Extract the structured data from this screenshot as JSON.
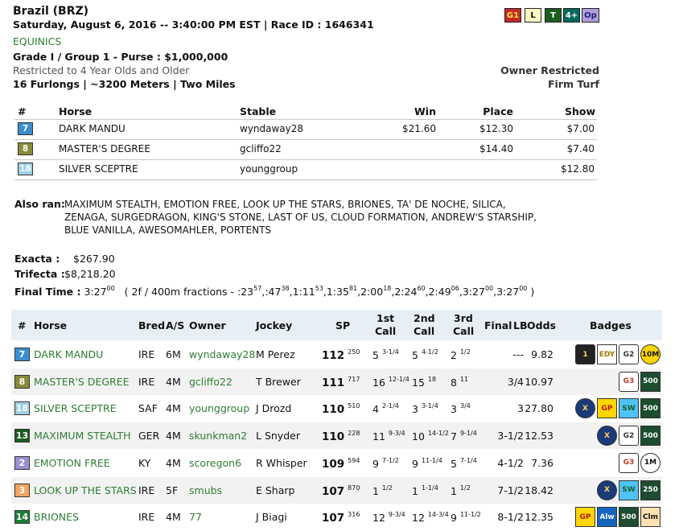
{
  "race": {
    "title": "Brazil (BRZ)",
    "date_line": "Saturday, August 6, 2016 -- 3:40:00 PM EST | Race ID : 1646341",
    "brand": "EQUINICS",
    "grade_line": "Grade I / Group 1 - Purse : $1,000,000",
    "restriction": "Restricted to 4 Year Olds and Older",
    "distance": "16 Furlongs | ~3200 Meters | Two Miles",
    "owner_restricted": "Owner Restricted",
    "surface": "Firm Turf",
    "tags": [
      {
        "label": "G1",
        "bg": "#c62828",
        "fg": "#ffeb3b"
      },
      {
        "label": "L",
        "bg": "#fff9c4",
        "fg": "#111"
      },
      {
        "label": "T",
        "bg": "#1b5e20",
        "fg": "#fff"
      },
      {
        "label": "4+",
        "bg": "#00695c",
        "fg": "#fff"
      },
      {
        "label": "Op",
        "bg": "#b39ddb",
        "fg": "#1a237e"
      }
    ]
  },
  "results": {
    "headers": {
      "num": "#",
      "horse": "Horse",
      "stable": "Stable",
      "win": "Win",
      "place": "Place",
      "show": "Show"
    },
    "rows": [
      {
        "pp": "7",
        "color": "#3a8fd0",
        "horse": "DARK MANDU",
        "stable": "wyndaway28",
        "win": "$21.60",
        "place": "$12.30",
        "show": "$7.00"
      },
      {
        "pp": "8",
        "color": "#8a8a3a",
        "horse": "MASTER'S DEGREE",
        "stable": "gcliffo22",
        "win": "",
        "place": "$14.40",
        "show": "$7.40"
      },
      {
        "pp": "18",
        "color": "#9ed0e6",
        "horse": "SILVER SCEPTRE",
        "stable": "younggroup",
        "win": "",
        "place": "",
        "show": "$12.80"
      }
    ]
  },
  "also_ran": {
    "label": "Also ran:",
    "lines": [
      "MAXIMUM STEALTH, EMOTION FREE, LOOK UP THE STARS, BRIONES, TA' DE NOCHE, SILICA,",
      "ZENAGA, SURGEDRAGON, KING'S STONE, LAST OF US, CLOUD FORMATION, ANDREW'S STARSHIP,",
      "BLUE VANILLA, AWESOMAHLER, PORTENTS"
    ]
  },
  "payouts": {
    "exacta_label": "Exacta :",
    "exacta": "$267.90",
    "trifecta_label": "Trifecta :",
    "trifecta": "$8,218.20"
  },
  "final_time": {
    "label": "Final Time :",
    "time_main": "3:27",
    "time_sup": "00",
    "fractions_intro": "( 2f / 400m fractions -",
    "fractions": [
      {
        "t": ":23",
        "s": "57"
      },
      {
        "t": ":47",
        "s": "38"
      },
      {
        "t": "1:11",
        "s": "53"
      },
      {
        "t": "1:35",
        "s": "81"
      },
      {
        "t": "2:00",
        "s": "18"
      },
      {
        "t": "2:24",
        "s": "60"
      },
      {
        "t": "2:49",
        "s": "06"
      },
      {
        "t": "3:27",
        "s": "00"
      },
      {
        "t": "3:27",
        "s": "00"
      }
    ],
    "close": ")"
  },
  "chart": {
    "headers": {
      "num": "#",
      "horse": "Horse",
      "bred": "Bred",
      "as": "A/S",
      "owner": "Owner",
      "jockey": "Jockey",
      "sp": "SP",
      "call1a": "1st",
      "call1b": "Call",
      "call2a": "2nd",
      "call2b": "Call",
      "call3a": "3rd",
      "call3b": "Call",
      "final": "Final",
      "lb": "LB",
      "odds": "Odds",
      "badges": "Badges"
    },
    "rows": [
      {
        "pp": "7",
        "color": "#3a8fd0",
        "horse": "DARK MANDU",
        "bred": "IRE",
        "as": "6M",
        "owner": "wyndaway28",
        "jockey": "M Perez",
        "sp": "112",
        "sps": "250",
        "c1": "5",
        "c1s": "3-1/4",
        "c2": "5",
        "c2s": "4-1/2",
        "c3": "2",
        "c3s": "1/2",
        "lb": "---",
        "odds": "9.82",
        "badges": [
          "gold-star-1",
          "gold-cup",
          "g2-star",
          "10m-disc"
        ]
      },
      {
        "pp": "8",
        "color": "#8a8a3a",
        "horse": "MASTER'S DEGREE",
        "bred": "IRE",
        "as": "4M",
        "owner": "gcliffo22",
        "jockey": "T Brewer",
        "sp": "111",
        "sps": "717",
        "c1": "16",
        "c1s": "12-1/4",
        "c2": "15",
        "c2s": "18",
        "c3": "8",
        "c3s": "11",
        "lb": "3/4",
        "odds": "10.97",
        "badges": [
          "g3-star",
          "500-box"
        ]
      },
      {
        "pp": "18",
        "color": "#9ed0e6",
        "horse": "SILVER SCEPTRE",
        "bred": "SAF",
        "as": "4M",
        "owner": "younggroup",
        "jockey": "J Drozd",
        "sp": "110",
        "sps": "510",
        "c1": "4",
        "c1s": "2-1/4",
        "c2": "3",
        "c2s": "3-1/4",
        "c3": "3",
        "c3s": "3/4",
        "lb": "3",
        "odds": "27.80",
        "badges": [
          "x-medal",
          "gp-box",
          "sw-box",
          "500-box"
        ]
      },
      {
        "pp": "13",
        "color": "#1b5e20",
        "horse": "MAXIMUM STEALTH",
        "bred": "GER",
        "as": "4M",
        "owner": "skunkman2",
        "jockey": "L Snyder",
        "sp": "110",
        "sps": "228",
        "c1": "11",
        "c1s": "9-3/4",
        "c2": "10",
        "c2s": "14-1/2",
        "c3": "7",
        "c3s": "9-1/4",
        "lb": "3-1/2",
        "odds": "12.53",
        "badges": [
          "x-medal",
          "g2-star",
          "500-box"
        ]
      },
      {
        "pp": "2",
        "color": "#9a8fd0",
        "horse": "EMOTION FREE",
        "bred": "KY",
        "as": "4M",
        "owner": "scoregon6",
        "jockey": "R Whisper",
        "sp": "109",
        "sps": "594",
        "c1": "9",
        "c1s": "7-1/2",
        "c2": "9",
        "c2s": "11-1/4",
        "c3": "5",
        "c3s": "7-1/4",
        "lb": "4-1/2",
        "odds": "7.36",
        "badges": [
          "g3-star",
          "1m-disc"
        ]
      },
      {
        "pp": "3",
        "color": "#f4a460",
        "horse": "LOOK UP THE STARS",
        "bred": "IRE",
        "as": "5F",
        "owner": "smubs",
        "jockey": "E Sharp",
        "sp": "107",
        "sps": "870",
        "c1": "1",
        "c1s": "1/2",
        "c2": "1",
        "c2s": "1-1/4",
        "c3": "1",
        "c3s": "1/2",
        "lb": "7-1/2",
        "odds": "18.42",
        "badges": [
          "x-medal",
          "sw-box",
          "250-box"
        ]
      },
      {
        "pp": "14",
        "color": "#1b7f3a",
        "horse": "BRIONES",
        "bred": "IRE",
        "as": "4M",
        "owner": "77",
        "jockey": "J Biagi",
        "sp": "107",
        "sps": "316",
        "c1": "12",
        "c1s": "9-3/4",
        "c2": "12",
        "c2s": "14-3/4",
        "c3": "9",
        "c3s": "11-1/2",
        "lb": "8-1/2",
        "odds": "12.35",
        "badges": [
          "gp-box",
          "alw-box",
          "500-box",
          "clm-box"
        ]
      }
    ]
  },
  "badge_styles": {
    "gold-star-1": {
      "label": "1",
      "bg": "#222",
      "fg": "#ffd54f"
    },
    "gold-cup": {
      "label": "EDY",
      "bg": "#fff",
      "fg": "#a07a00"
    },
    "g2-star": {
      "label": "G2",
      "bg": "#fff",
      "fg": "#333"
    },
    "g3-star": {
      "label": "G3",
      "bg": "#fff",
      "fg": "#c0392b"
    },
    "10m-disc": {
      "label": "10M",
      "bg": "#ffd600",
      "fg": "#111"
    },
    "1m-disc": {
      "label": "1M",
      "bg": "#fff",
      "fg": "#111"
    },
    "500-box": {
      "label": "500",
      "bg": "#1b4d2e",
      "fg": "#fff"
    },
    "250-box": {
      "label": "250",
      "bg": "#1b4d2e",
      "fg": "#fff"
    },
    "x-medal": {
      "label": "X",
      "bg": "#1a3a7a",
      "fg": "#ffd54f"
    },
    "gp-box": {
      "label": "GP",
      "bg": "#ffd600",
      "fg": "#b71c1c"
    },
    "sw-box": {
      "label": "SW",
      "bg": "#4fc3f7",
      "fg": "#1b5e20"
    },
    "alw-box": {
      "label": "Alw",
      "bg": "#1565c0",
      "fg": "#fff"
    },
    "clm-box": {
      "label": "Clm",
      "bg": "#ffe0b2",
      "fg": "#111"
    }
  }
}
